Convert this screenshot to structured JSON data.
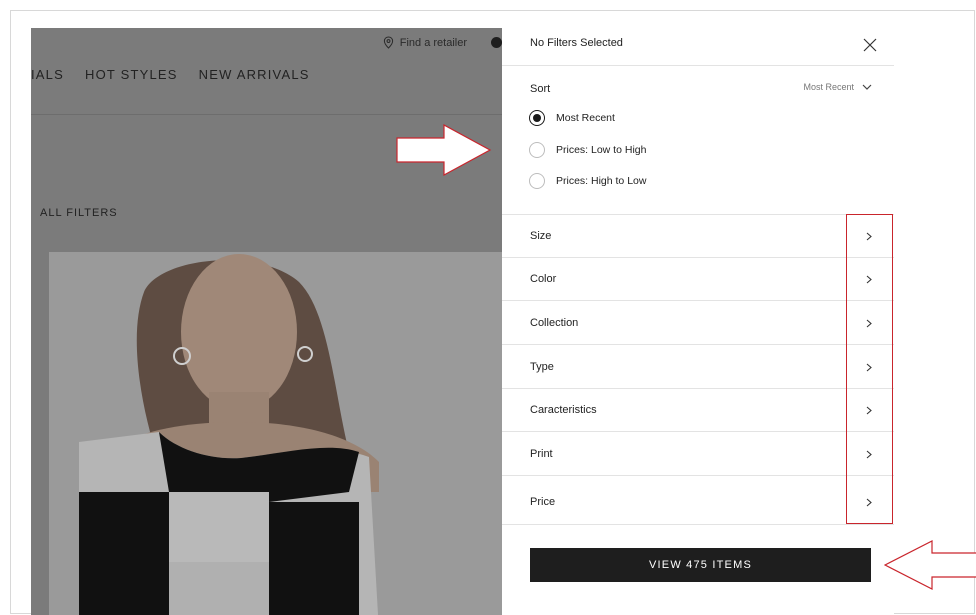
{
  "background_page": {
    "utility_link": "Find a retailer",
    "nav_items": [
      "IALS",
      "HOT STYLES",
      "NEW ARRIVALS"
    ],
    "all_filters_label": "ALL FILTERS"
  },
  "panel": {
    "title": "No Filters Selected",
    "sort": {
      "label": "Sort",
      "current": "Most Recent",
      "options": [
        {
          "label": "Most Recent",
          "checked": true
        },
        {
          "label": "Prices: Low to High",
          "checked": false
        },
        {
          "label": "Prices: High to Low",
          "checked": false
        }
      ]
    },
    "filters": [
      {
        "label": "Size"
      },
      {
        "label": "Color"
      },
      {
        "label": "Collection"
      },
      {
        "label": "Type"
      },
      {
        "label": "Caracteristics"
      },
      {
        "label": "Print"
      },
      {
        "label": "Price"
      }
    ],
    "view_button_label": "VIEW 475 ITEMS"
  },
  "colors": {
    "overlay_grey": "#7b7b7b",
    "button_bg": "#1e1e1e",
    "annotation_red": "#c9252c"
  }
}
